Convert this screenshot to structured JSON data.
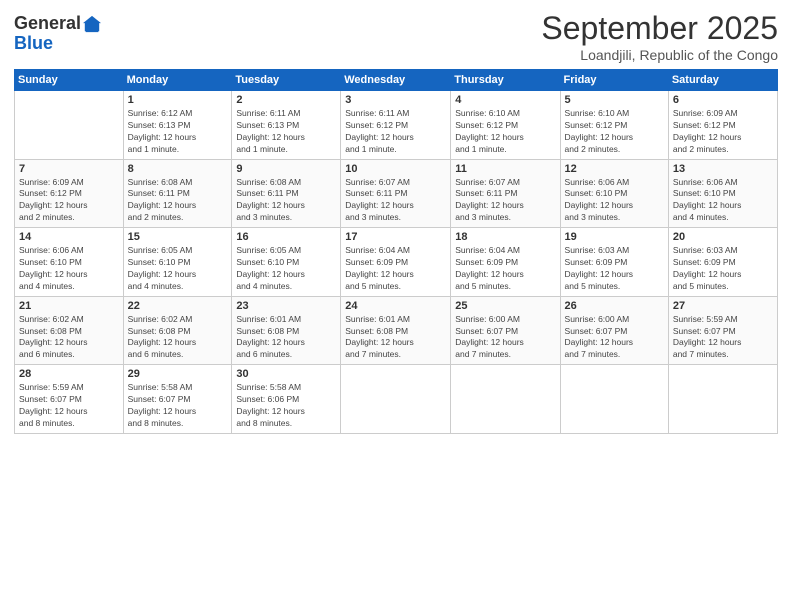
{
  "header": {
    "logo_general": "General",
    "logo_blue": "Blue",
    "month": "September 2025",
    "location": "Loandjili, Republic of the Congo"
  },
  "weekdays": [
    "Sunday",
    "Monday",
    "Tuesday",
    "Wednesday",
    "Thursday",
    "Friday",
    "Saturday"
  ],
  "weeks": [
    [
      {
        "day": "",
        "info": ""
      },
      {
        "day": "1",
        "info": "Sunrise: 6:12 AM\nSunset: 6:13 PM\nDaylight: 12 hours\nand 1 minute."
      },
      {
        "day": "2",
        "info": "Sunrise: 6:11 AM\nSunset: 6:13 PM\nDaylight: 12 hours\nand 1 minute."
      },
      {
        "day": "3",
        "info": "Sunrise: 6:11 AM\nSunset: 6:12 PM\nDaylight: 12 hours\nand 1 minute."
      },
      {
        "day": "4",
        "info": "Sunrise: 6:10 AM\nSunset: 6:12 PM\nDaylight: 12 hours\nand 1 minute."
      },
      {
        "day": "5",
        "info": "Sunrise: 6:10 AM\nSunset: 6:12 PM\nDaylight: 12 hours\nand 2 minutes."
      },
      {
        "day": "6",
        "info": "Sunrise: 6:09 AM\nSunset: 6:12 PM\nDaylight: 12 hours\nand 2 minutes."
      }
    ],
    [
      {
        "day": "7",
        "info": "Sunrise: 6:09 AM\nSunset: 6:12 PM\nDaylight: 12 hours\nand 2 minutes."
      },
      {
        "day": "8",
        "info": "Sunrise: 6:08 AM\nSunset: 6:11 PM\nDaylight: 12 hours\nand 2 minutes."
      },
      {
        "day": "9",
        "info": "Sunrise: 6:08 AM\nSunset: 6:11 PM\nDaylight: 12 hours\nand 3 minutes."
      },
      {
        "day": "10",
        "info": "Sunrise: 6:07 AM\nSunset: 6:11 PM\nDaylight: 12 hours\nand 3 minutes."
      },
      {
        "day": "11",
        "info": "Sunrise: 6:07 AM\nSunset: 6:11 PM\nDaylight: 12 hours\nand 3 minutes."
      },
      {
        "day": "12",
        "info": "Sunrise: 6:06 AM\nSunset: 6:10 PM\nDaylight: 12 hours\nand 3 minutes."
      },
      {
        "day": "13",
        "info": "Sunrise: 6:06 AM\nSunset: 6:10 PM\nDaylight: 12 hours\nand 4 minutes."
      }
    ],
    [
      {
        "day": "14",
        "info": "Sunrise: 6:06 AM\nSunset: 6:10 PM\nDaylight: 12 hours\nand 4 minutes."
      },
      {
        "day": "15",
        "info": "Sunrise: 6:05 AM\nSunset: 6:10 PM\nDaylight: 12 hours\nand 4 minutes."
      },
      {
        "day": "16",
        "info": "Sunrise: 6:05 AM\nSunset: 6:10 PM\nDaylight: 12 hours\nand 4 minutes."
      },
      {
        "day": "17",
        "info": "Sunrise: 6:04 AM\nSunset: 6:09 PM\nDaylight: 12 hours\nand 5 minutes."
      },
      {
        "day": "18",
        "info": "Sunrise: 6:04 AM\nSunset: 6:09 PM\nDaylight: 12 hours\nand 5 minutes."
      },
      {
        "day": "19",
        "info": "Sunrise: 6:03 AM\nSunset: 6:09 PM\nDaylight: 12 hours\nand 5 minutes."
      },
      {
        "day": "20",
        "info": "Sunrise: 6:03 AM\nSunset: 6:09 PM\nDaylight: 12 hours\nand 5 minutes."
      }
    ],
    [
      {
        "day": "21",
        "info": "Sunrise: 6:02 AM\nSunset: 6:08 PM\nDaylight: 12 hours\nand 6 minutes."
      },
      {
        "day": "22",
        "info": "Sunrise: 6:02 AM\nSunset: 6:08 PM\nDaylight: 12 hours\nand 6 minutes."
      },
      {
        "day": "23",
        "info": "Sunrise: 6:01 AM\nSunset: 6:08 PM\nDaylight: 12 hours\nand 6 minutes."
      },
      {
        "day": "24",
        "info": "Sunrise: 6:01 AM\nSunset: 6:08 PM\nDaylight: 12 hours\nand 7 minutes."
      },
      {
        "day": "25",
        "info": "Sunrise: 6:00 AM\nSunset: 6:07 PM\nDaylight: 12 hours\nand 7 minutes."
      },
      {
        "day": "26",
        "info": "Sunrise: 6:00 AM\nSunset: 6:07 PM\nDaylight: 12 hours\nand 7 minutes."
      },
      {
        "day": "27",
        "info": "Sunrise: 5:59 AM\nSunset: 6:07 PM\nDaylight: 12 hours\nand 7 minutes."
      }
    ],
    [
      {
        "day": "28",
        "info": "Sunrise: 5:59 AM\nSunset: 6:07 PM\nDaylight: 12 hours\nand 8 minutes."
      },
      {
        "day": "29",
        "info": "Sunrise: 5:58 AM\nSunset: 6:07 PM\nDaylight: 12 hours\nand 8 minutes."
      },
      {
        "day": "30",
        "info": "Sunrise: 5:58 AM\nSunset: 6:06 PM\nDaylight: 12 hours\nand 8 minutes."
      },
      {
        "day": "",
        "info": ""
      },
      {
        "day": "",
        "info": ""
      },
      {
        "day": "",
        "info": ""
      },
      {
        "day": "",
        "info": ""
      }
    ]
  ]
}
